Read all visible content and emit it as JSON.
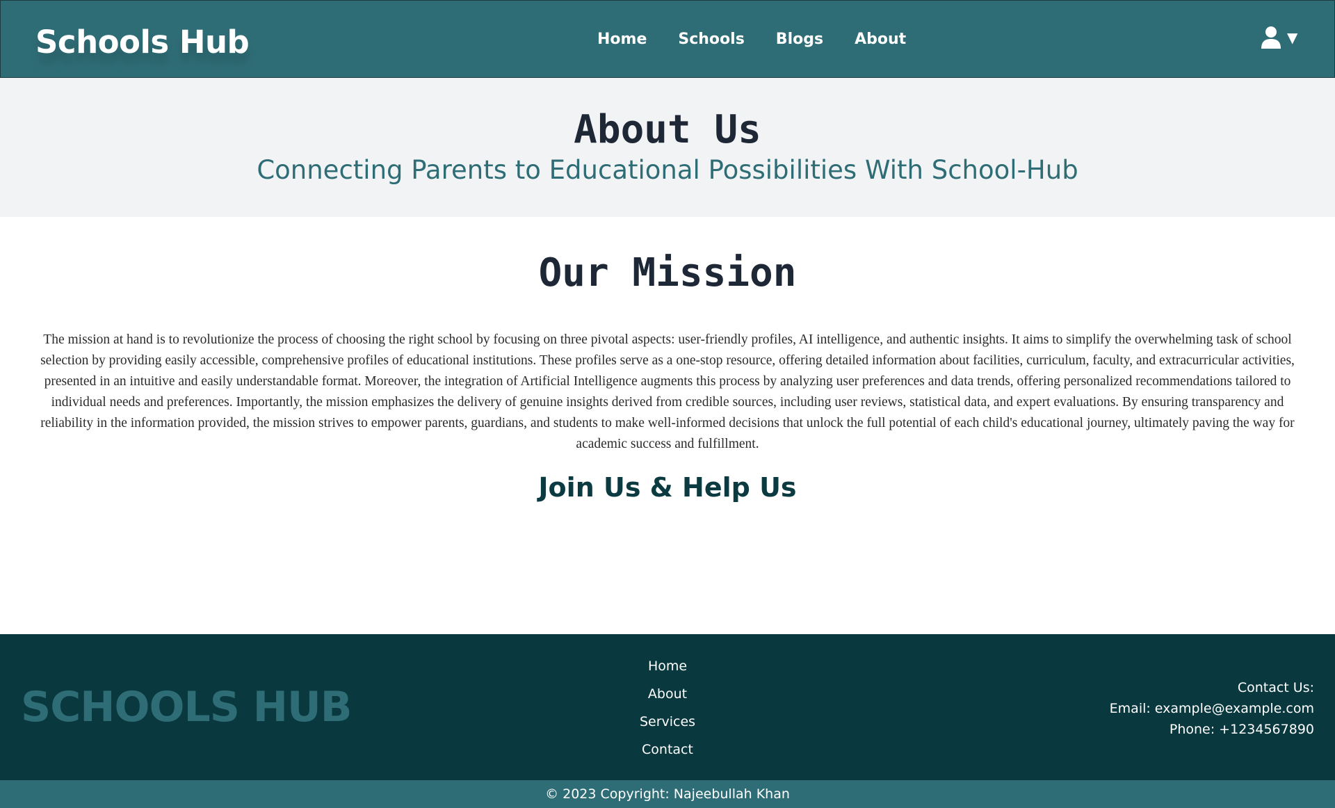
{
  "header": {
    "brand": "Schools Hub",
    "nav": [
      "Home",
      "Schools",
      "Blogs",
      "About"
    ],
    "user_caret": "▼"
  },
  "hero": {
    "title": "About Us",
    "subtitle": "Connecting Parents to Educational Possibilities With School-Hub"
  },
  "mission": {
    "title": "Our Mission",
    "text": "The mission at hand is to revolutionize the process of choosing the right school by focusing on three pivotal aspects: user-friendly profiles, AI intelligence, and authentic insights. It aims to simplify the overwhelming task of school selection by providing easily accessible, comprehensive profiles of educational institutions. These profiles serve as a one-stop resource, offering detailed information about facilities, curriculum, faculty, and extracurricular activities, presented in an intuitive and easily understandable format. Moreover, the integration of Artificial Intelligence augments this process by analyzing user preferences and data trends, offering personalized recommendations tailored to individual needs and preferences. Importantly, the mission emphasizes the delivery of genuine insights derived from credible sources, including user reviews, statistical data, and expert evaluations. By ensuring transparency and reliability in the information provided, the mission strives to empower parents, guardians, and students to make well-informed decisions that unlock the full potential of each child's educational journey, ultimately paving the way for academic success and fulfillment.",
    "join_title": "Join Us & Help Us"
  },
  "footer": {
    "brand": "SCHOOLS HUB",
    "links": [
      "Home",
      "About",
      "Services",
      "Contact"
    ],
    "contact_title": "Contact Us:",
    "email": "Email: example@example.com",
    "phone": "Phone: +1234567890",
    "copyright": "© 2023 Copyright:  Najeebullah Khan"
  },
  "colors": {
    "primary": "#2f6d76",
    "footer_bg": "#09383e",
    "hero_bg": "#f2f3f4",
    "heading": "#1e2736"
  },
  "icons": {
    "user": "user-icon",
    "caret": "caret-down-icon"
  }
}
